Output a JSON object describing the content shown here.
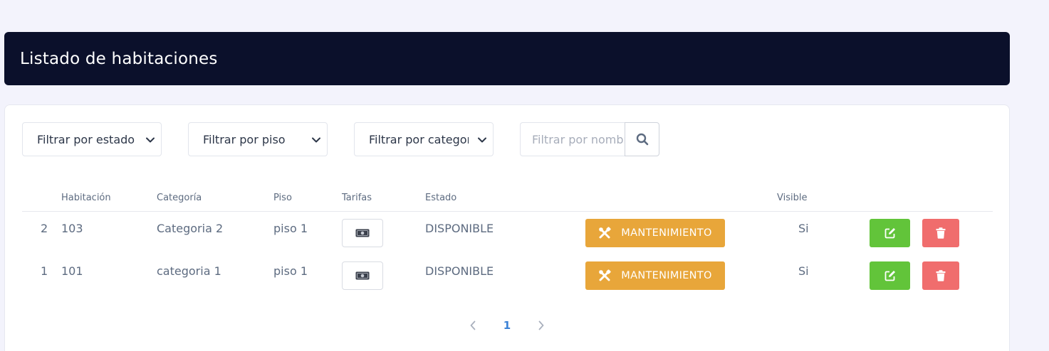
{
  "header": {
    "title": "Listado de habitaciones"
  },
  "filters": {
    "estado_label": "Filtrar por estado",
    "piso_label": "Filtrar por piso",
    "categoria_label": "Filtrar por categoria",
    "nombre_placeholder": "Filtrar por nombre"
  },
  "table": {
    "headers": {
      "habitacion": "Habitación",
      "categoria": "Categoría",
      "piso": "Piso",
      "tarifas": "Tarifas",
      "estado": "Estado",
      "visible": "Visible"
    },
    "rows": [
      {
        "index": "2",
        "habitacion": "103",
        "categoria": "Categoria 2",
        "piso": "piso 1",
        "estado": "DISPONIBLE",
        "action": "MANTENIMIENTO",
        "visible": "Si"
      },
      {
        "index": "1",
        "habitacion": "101",
        "categoria": "categoria 1",
        "piso": "piso 1",
        "estado": "DISPONIBLE",
        "action": "MANTENIMIENTO",
        "visible": "Si"
      }
    ]
  },
  "pagination": {
    "current": "1"
  },
  "colors": {
    "header_bg": "#0b102b",
    "maintenance": "#e8a63a",
    "edit": "#62c43a",
    "delete": "#f06d6d",
    "page_active": "#3b82d6"
  },
  "icons": {
    "select_chevron": "chevron-down-icon",
    "search": "search-icon",
    "tarifa": "money-bill-icon",
    "maintenance": "tools-icon",
    "edit": "edit-icon",
    "delete": "trash-icon",
    "prev": "chevron-left-icon",
    "next": "chevron-right-icon"
  }
}
